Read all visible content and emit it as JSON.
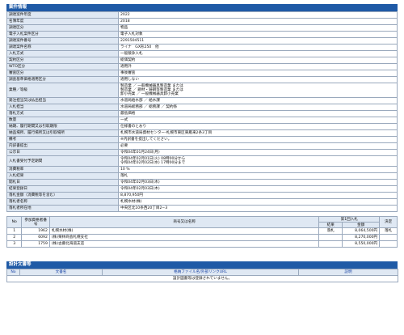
{
  "section_title": "案件情報",
  "fields": [
    {
      "label": "調達案件年度",
      "value": [
        "2022"
      ]
    },
    {
      "label": "名簿年度",
      "value": [
        "2018"
      ]
    },
    {
      "label": "調達区分",
      "value": [
        "物品"
      ]
    },
    {
      "label": "電子入札案件区分",
      "value": [
        "電子入札対象"
      ]
    },
    {
      "label": "調達案件番号",
      "value": [
        "2291504511"
      ]
    },
    {
      "label": "調達案件名称",
      "value": [
        "ライナ　GX形250　他"
      ]
    },
    {
      "label": "入札方式",
      "value": [
        "一般競争入札"
      ]
    },
    {
      "label": "契約区分",
      "value": [
        "総価契約"
      ]
    },
    {
      "label": "WTO区分",
      "value": [
        "適用外"
      ]
    },
    {
      "label": "審査区分",
      "value": [
        "事後審査"
      ]
    },
    {
      "label": "調査基準価格適用区分",
      "value": [
        "適用しない"
      ]
    },
    {
      "label": "業種／等級",
      "value": [
        "製造業 ／ 一般機械器具製造業 または",
        "製造業 ／ 鋼材・鋳鋼等製造業 または",
        "卸小売業 ／ 一般機械器具卸小売業"
      ]
    },
    {
      "label": "発注担当又は払出担当",
      "value": [
        "水道局給水部 ／ 給水課"
      ]
    },
    {
      "label": "入札担当",
      "value": [
        "水道局総務部 ／ 総務課 ／ 契約係"
      ]
    },
    {
      "label": "落札方式",
      "value": [
        "最低価格"
      ]
    },
    {
      "label": "数量",
      "value": [
        "一式"
      ]
    },
    {
      "label": "納期、履行期間又は引取期限",
      "value": [
        "仕様書のとおり"
      ]
    },
    {
      "label": "納品場所、履行場所又は引取場所",
      "value": [
        "札幌市水道局資材センター-札幌市東区東雁来2条3丁目"
      ]
    },
    {
      "label": "備考",
      "value": [
        "※内訳書を提出してください。"
      ]
    },
    {
      "label": "内訳書提出",
      "value": [
        "必要"
      ]
    },
    {
      "label": "公示日",
      "value": [
        "令和04年01月24日(月)"
      ]
    },
    {
      "label": "入札書受付予定期間",
      "value": [
        "令和04年02月01日(火) 08時00分から",
        "令和04年02月02日(水) 17時00分まで"
      ]
    },
    {
      "label": "消費税率",
      "value": [
        "10 %"
      ]
    },
    {
      "label": "入札結果",
      "value": [
        "落札"
      ]
    },
    {
      "label": "開札日",
      "value": [
        "令和04年02月03日(木)"
      ]
    },
    {
      "label": "結果登録日",
      "value": [
        "令和04年02月03日(木)"
      ]
    },
    {
      "label": "落札金額（消費税等を含む）",
      "value": [
        "8,870,950円"
      ]
    },
    {
      "label": "落札者名称",
      "value": [
        "札幌水材(株)"
      ]
    },
    {
      "label": "落札者所在地",
      "value": [
        "中央区北10条西20丁目2−3"
      ]
    }
  ],
  "bidders": {
    "headers": {
      "no": "No",
      "reg_no": "参加資格者番号",
      "name": "商号又は名称",
      "round1": "第1回入札",
      "result": "結果",
      "amount": "金額",
      "decision": "決定"
    },
    "rows": [
      {
        "no": "1",
        "reg_no": "1962",
        "name": "札幌水材(株)",
        "result": "落札",
        "amount": "8,064,500円",
        "decision": "落札"
      },
      {
        "no": "2",
        "reg_no": "6092",
        "name": "(株)栗林商会札幌支社",
        "result": "",
        "amount": "8,270,000円",
        "decision": ""
      },
      {
        "no": "3",
        "reg_no": "1759",
        "name": "(株)古藤北海道支店",
        "result": "",
        "amount": "8,550,000円",
        "decision": ""
      }
    ]
  },
  "documents": {
    "title": "設計文書等",
    "headers": {
      "no": "No",
      "doc_name": "文書名",
      "file": "格納ファイル名/外部リンクURL",
      "note": "説明"
    },
    "empty_message": "設計図書等は登録されていません。"
  }
}
